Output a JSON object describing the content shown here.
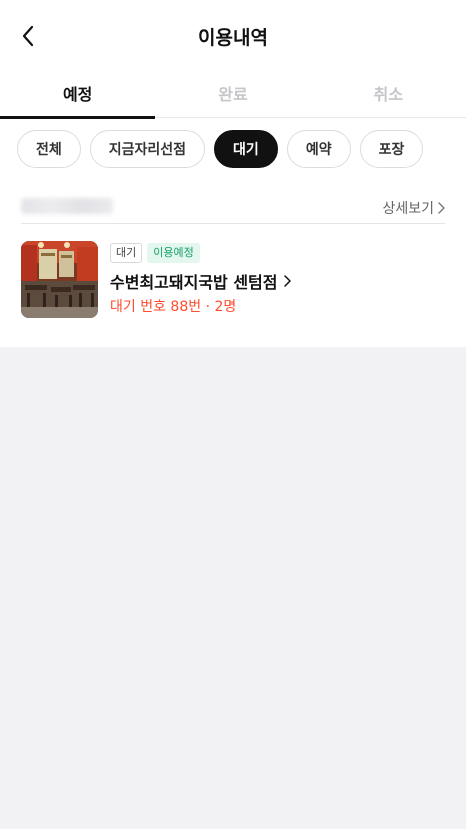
{
  "header": {
    "title": "이용내역"
  },
  "tabs": [
    {
      "label": "예정",
      "active": true
    },
    {
      "label": "완료",
      "active": false
    },
    {
      "label": "취소",
      "active": false
    }
  ],
  "filters": [
    {
      "label": "전체",
      "selected": false
    },
    {
      "label": "지금자리선점",
      "selected": false
    },
    {
      "label": "대기",
      "selected": true
    },
    {
      "label": "예약",
      "selected": false
    },
    {
      "label": "포장",
      "selected": false
    }
  ],
  "section": {
    "detail_label": "상세보기"
  },
  "booking": {
    "type_badge": "대기",
    "status_badge": "이용예정",
    "store_name": "수변최고돼지국밥 센텀점",
    "queue_info": "대기 번호 88번 · 2명"
  },
  "colors": {
    "accent_red": "#ff4b2b",
    "badge_green": "#19a06a",
    "selected_chip": "#111111",
    "background": "#f2f2f4"
  },
  "icons": {
    "back": "chevron-left-icon",
    "detail": "chevron-right-icon",
    "store": "chevron-right-icon"
  }
}
